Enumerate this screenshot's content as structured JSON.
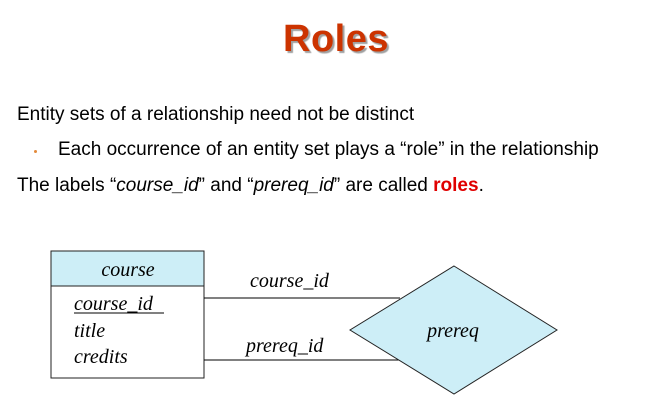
{
  "slide": {
    "title": "Roles",
    "line1": "Entity sets of a relationship need not be distinct",
    "line2": "Each occurrence of an entity set plays a “role” in the relationship",
    "line3": {
      "prefix": "The labels “",
      "label1": "course_id",
      "middle": "” and “",
      "label2": "prereq_id",
      "suffix": "” are called ",
      "roles": "roles",
      "end": "."
    }
  },
  "diagram": {
    "entity": {
      "name": "course",
      "attributes": [
        "course_id",
        "title",
        "credits"
      ],
      "primary_key": "course_id"
    },
    "relationship": {
      "name": "prereq"
    },
    "role_labels": [
      "course_id",
      "prereq_id"
    ],
    "colors": {
      "entity_header": "#cdeef7",
      "title": "#cc3300",
      "roles_highlight": "#e00000"
    }
  }
}
